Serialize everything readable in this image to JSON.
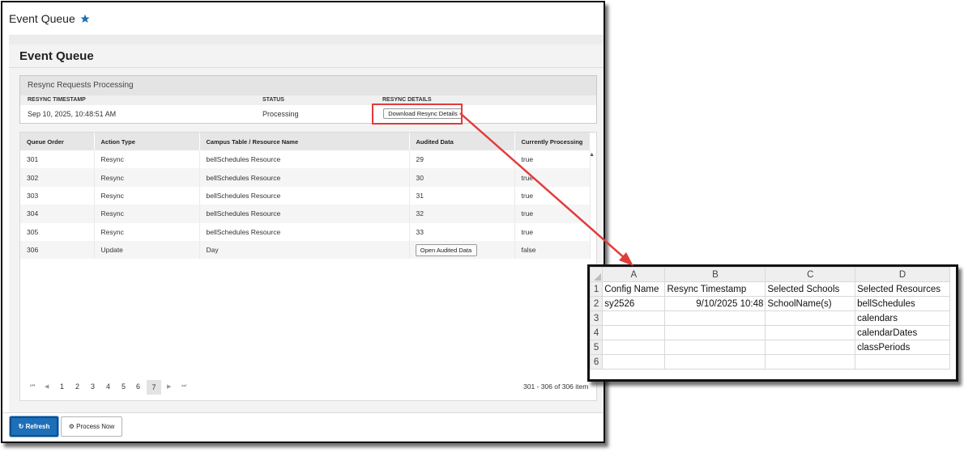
{
  "window": {
    "title": "Event Queue"
  },
  "page": {
    "title": "Event Queue"
  },
  "resync": {
    "header": "Resync Requests Processing",
    "columns": {
      "timestamp": "RESYNC TIMESTAMP",
      "status": "STATUS",
      "details": "RESYNC DETAILS"
    },
    "row": {
      "timestamp": "Sep 10, 2025, 10:48:51 AM",
      "status": "Processing",
      "button": "Download Resync Details"
    }
  },
  "queue": {
    "columns": [
      "Queue Order",
      "Action Type",
      "Campus Table / Resource Name",
      "Audited Data",
      "Currently Processing"
    ],
    "rows": [
      {
        "order": "301",
        "action": "Resync",
        "resource": "bellSchedules Resource",
        "audited": "29",
        "processing": "true"
      },
      {
        "order": "302",
        "action": "Resync",
        "resource": "bellSchedules Resource",
        "audited": "30",
        "processing": "true"
      },
      {
        "order": "303",
        "action": "Resync",
        "resource": "bellSchedules Resource",
        "audited": "31",
        "processing": "true"
      },
      {
        "order": "304",
        "action": "Resync",
        "resource": "bellSchedules Resource",
        "audited": "32",
        "processing": "true"
      },
      {
        "order": "305",
        "action": "Resync",
        "resource": "bellSchedules Resource",
        "audited": "33",
        "processing": "true"
      },
      {
        "order": "306",
        "action": "Update",
        "resource": "Day",
        "audited_button": "Open Audited Data",
        "processing": "false"
      }
    ]
  },
  "pagination": {
    "first": "⏮",
    "prev": "◀",
    "next": "▶",
    "last": "⏭",
    "pages": [
      "1",
      "2",
      "3",
      "4",
      "5",
      "6",
      "7"
    ],
    "active": "7",
    "summary": "301 - 306 of 306 item"
  },
  "footer": {
    "refresh_label": "Refresh",
    "process_label": "Process Now"
  },
  "spreadsheet": {
    "column_letters": [
      "A",
      "B",
      "C",
      "D"
    ],
    "row_numbers": [
      "1",
      "2",
      "3",
      "4",
      "5",
      "6"
    ],
    "cells": [
      [
        "Config Name",
        "Resync Timestamp",
        "Selected Schools",
        "Selected Resources"
      ],
      [
        "sy2526",
        "9/10/2025 10:48",
        "SchoolName(s)",
        "bellSchedules"
      ],
      [
        "",
        "",
        "",
        "calendars"
      ],
      [
        "",
        "",
        "",
        "calendarDates"
      ],
      [
        "",
        "",
        "",
        "classPeriods"
      ],
      [
        "",
        "",
        "",
        ""
      ]
    ]
  },
  "colors": {
    "accent": "#1d6fb8",
    "highlight": "#e23b3b",
    "star": "#1d6fb8"
  }
}
